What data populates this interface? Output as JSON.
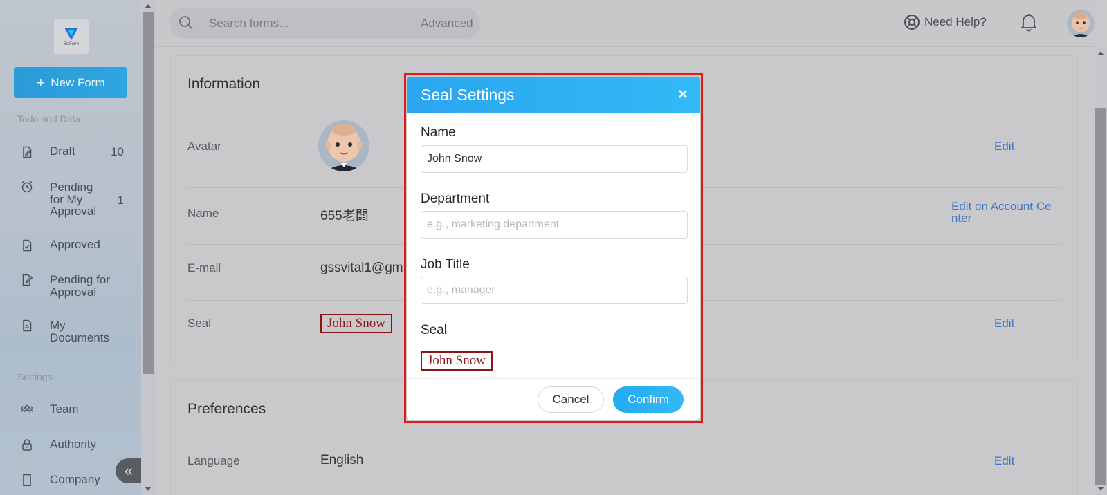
{
  "brand": {
    "logo_text": "BizForm",
    "logo_icon": "bizform-logo"
  },
  "sidebar": {
    "new_form_label": "New Form",
    "todo_section": "Todo and Data",
    "settings_section": "Settings",
    "items": [
      {
        "label": "Draft",
        "count": "10",
        "icon": "draft-icon"
      },
      {
        "label": "Pending for My Approval",
        "count": "1",
        "icon": "alarm-icon"
      },
      {
        "label": "Approved",
        "count": "",
        "icon": "approved-doc-icon"
      },
      {
        "label": "Pending for Approval",
        "count": "",
        "icon": "edit-doc-icon"
      },
      {
        "label": "My Documents",
        "count": "",
        "icon": "documents-icon"
      },
      {
        "label": "Team",
        "count": "",
        "icon": "team-icon"
      },
      {
        "label": "Authority",
        "count": "",
        "icon": "lock-icon"
      },
      {
        "label": "Company",
        "count": "",
        "icon": "building-icon"
      }
    ],
    "collapse_glyph": "«"
  },
  "header": {
    "search_placeholder": "Search forms...",
    "advanced_label": "Advanced",
    "help_label": "Need Help?"
  },
  "info": {
    "title": "Information",
    "avatar_label": "Avatar",
    "name_label": "Name",
    "name_value": "655老闆",
    "email_label": "E-mail",
    "email_value": "gssvital1@gm",
    "seal_label": "Seal",
    "seal_value": "John Snow",
    "edit_label": "Edit",
    "edit_account_label": "Edit on Account Center"
  },
  "preferences": {
    "title": "Preferences",
    "language_label": "Language",
    "language_value": "English",
    "edit_label": "Edit"
  },
  "modal": {
    "title": "Seal Settings",
    "close_glyph": "×",
    "name_label": "Name",
    "name_value": "John Snow",
    "department_label": "Department",
    "department_placeholder": "e.g., marketing department",
    "job_title_label": "Job Title",
    "job_title_placeholder": "e.g., manager",
    "seal_label": "Seal",
    "seal_preview": "John Snow",
    "cancel_label": "Cancel",
    "confirm_label": "Confirm"
  },
  "colors": {
    "accent": "#2fa5e2",
    "seal": "#8b1515",
    "highlight": "#e01b1b",
    "link": "#3c74c8"
  }
}
